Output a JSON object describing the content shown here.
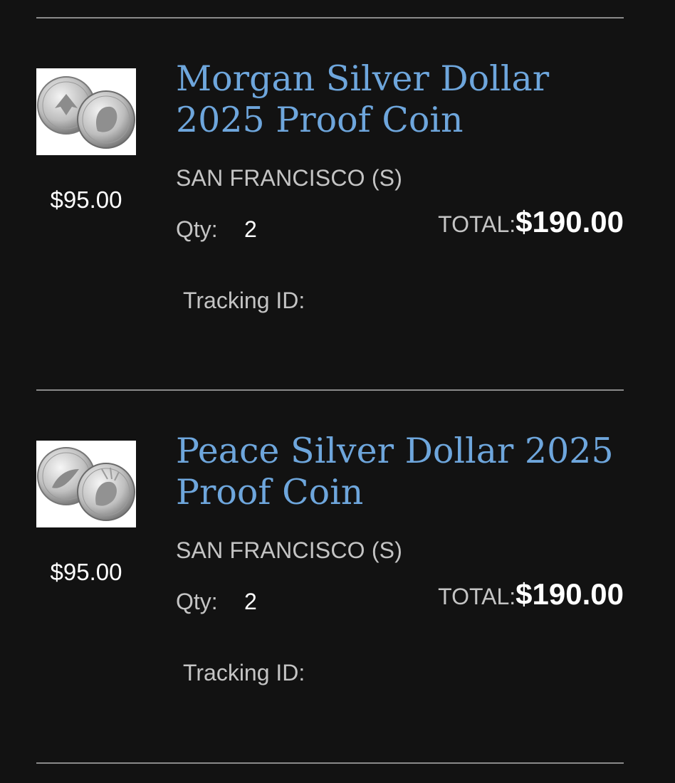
{
  "items": [
    {
      "image_icon": "morgan-silver-dollar-coins",
      "unit_price": "$95.00",
      "title": "Morgan Silver Dollar 2025 Proof Coin",
      "mint": "SAN FRANCISCO (S)",
      "qty_label": "Qty:",
      "qty": "2",
      "total_label": "TOTAL:",
      "total": "$190.00",
      "tracking_label": "Tracking ID:"
    },
    {
      "image_icon": "peace-silver-dollar-coins",
      "unit_price": "$95.00",
      "title": "Peace Silver Dollar 2025 Proof Coin",
      "mint": "SAN FRANCISCO (S)",
      "qty_label": "Qty:",
      "qty": "2",
      "total_label": "TOTAL:",
      "total": "$190.00",
      "tracking_label": "Tracking ID:"
    }
  ],
  "colors": {
    "background": "#121212",
    "title_link": "#6ea6dc",
    "muted_text": "#c4c4c4",
    "divider": "#8a8a8a"
  }
}
